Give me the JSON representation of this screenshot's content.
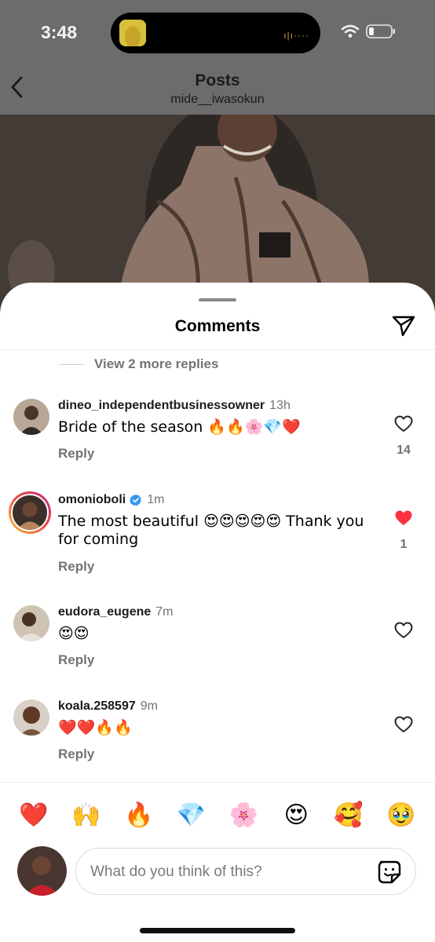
{
  "status_bar": {
    "time": "3:48"
  },
  "nav": {
    "title": "Posts",
    "subtitle": "mide__iwasokun"
  },
  "sheet": {
    "title": "Comments",
    "more_replies": "View 2 more replies"
  },
  "comments": [
    {
      "username": "dineo_independentbusinessowner",
      "time": "13h",
      "text": "Bride of the season 🔥🔥🌸💎❤️",
      "reply": "Reply",
      "likes": "14",
      "liked": false
    },
    {
      "username": "omonioboli",
      "verified": true,
      "time": "1m",
      "text": "The most beautiful 😍😍😍😍😍 Thank you for coming",
      "reply": "Reply",
      "likes": "1",
      "liked": true
    },
    {
      "username": "eudora_eugene",
      "time": "7m",
      "text": "😍😍",
      "reply": "Reply",
      "liked": false
    },
    {
      "username": "koala.258597",
      "time": "9m",
      "text": "❤️❤️🔥🔥",
      "reply": "Reply",
      "liked": false
    }
  ],
  "reactions": [
    "❤️",
    "🙌",
    "🔥",
    "💎",
    "🌸",
    "😍",
    "🥰",
    "🥹"
  ],
  "composer": {
    "placeholder": "What do you think of this?"
  },
  "colors": {
    "like_red": "#ff3040",
    "secondary_text": "#737373",
    "verified_blue": "#3897f0"
  },
  "icons": {
    "nav": [
      "back-icon"
    ],
    "sheet": [
      "send-icon"
    ],
    "comment": [
      "heart-icon",
      "verified-icon"
    ],
    "composer": [
      "sticker-icon"
    ]
  }
}
